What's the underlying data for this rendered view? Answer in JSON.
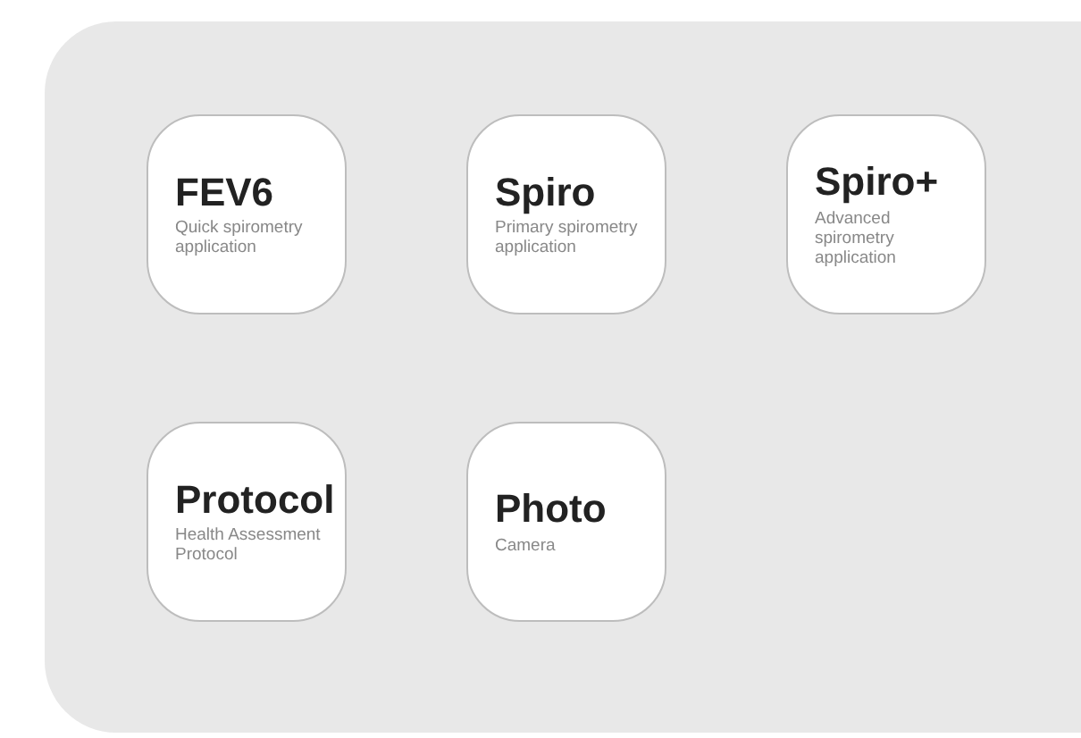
{
  "apps": [
    {
      "title": "FEV6",
      "description": "Quick spirometry application"
    },
    {
      "title": "Spiro",
      "description": "Primary spirometry application"
    },
    {
      "title": "Spiro+",
      "description": "Advanced spirometry application"
    },
    {
      "title": "Protocol",
      "description": "Health Assessment Protocol"
    },
    {
      "title": "Photo",
      "description": "Camera"
    }
  ]
}
